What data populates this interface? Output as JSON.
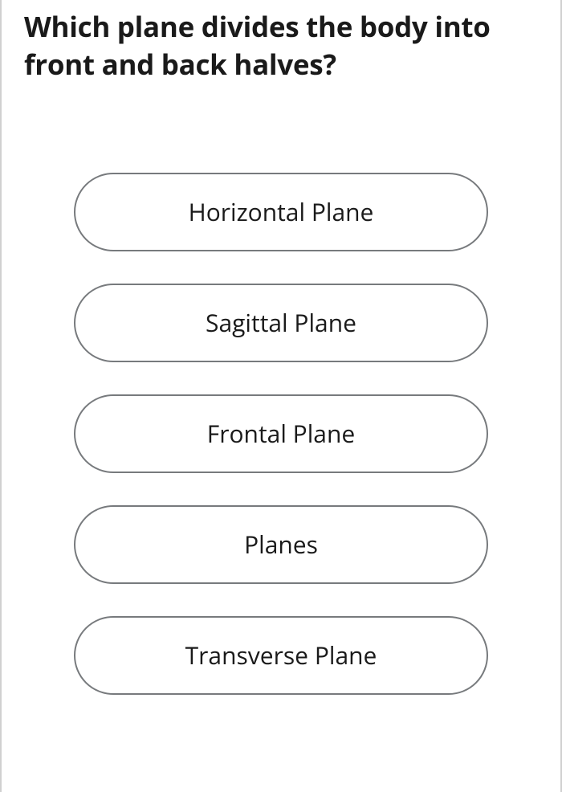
{
  "question": "Which plane divides the body into front and back halves?",
  "options": [
    {
      "label": "Horizontal Plane"
    },
    {
      "label": "Sagittal Plane"
    },
    {
      "label": "Frontal Plane"
    },
    {
      "label": "Planes"
    },
    {
      "label": "Transverse Plane"
    }
  ]
}
